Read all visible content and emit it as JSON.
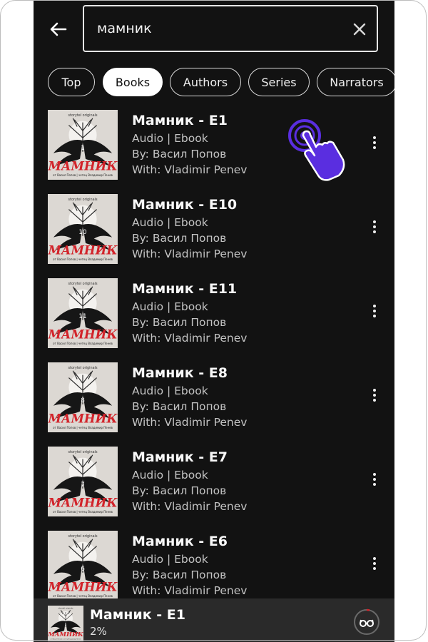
{
  "search": {
    "query": "мамник"
  },
  "tabs": [
    {
      "label": "Top",
      "active": false
    },
    {
      "label": "Books",
      "active": true
    },
    {
      "label": "Authors",
      "active": false
    },
    {
      "label": "Series",
      "active": false
    },
    {
      "label": "Narrators",
      "active": false
    }
  ],
  "results": [
    {
      "title": "Мамник - E1",
      "format": "Audio | Ebook",
      "author": "By: Васил Попов",
      "narrator": "With: Vladimir Penev",
      "cover_number": "1"
    },
    {
      "title": "Мамник - E10",
      "format": "Audio | Ebook",
      "author": "By: Васил Попов",
      "narrator": "With: Vladimir Penev",
      "cover_number": "10"
    },
    {
      "title": "Мамник - E11",
      "format": "Audio | Ebook",
      "author": "By: Васил Попов",
      "narrator": "With: Vladimir Penev",
      "cover_number": "11"
    },
    {
      "title": "Мамник - E8",
      "format": "Audio | Ebook",
      "author": "By: Васил Попов",
      "narrator": "With: Vladimir Penev",
      "cover_number": "8"
    },
    {
      "title": "Мамник - E7",
      "format": "Audio | Ebook",
      "author": "By: Васил Попов",
      "narrator": "With: Vladimir Penev",
      "cover_number": "7"
    },
    {
      "title": "Мамник - E6",
      "format": "Audio | Ebook",
      "author": "By: Васил Попов",
      "narrator": "With: Vladimir Penev",
      "cover_number": "6"
    }
  ],
  "cover_art": {
    "title": "МАМНИК",
    "brand": "storytel originals",
    "credits": "от Васил Попов | четец Владимир Пенев"
  },
  "player": {
    "title": "Мамник - E1",
    "progress": "2%",
    "cover_number": "1"
  },
  "colors": {
    "background": "#121212",
    "player_bg": "#2a2a2a",
    "tap_hint": "#5a2ee0",
    "accent_red": "#d2232a"
  },
  "icons": {
    "back": "arrow-left-icon",
    "clear": "close-icon",
    "more": "more-vertical-icon",
    "player": "reading-glasses-icon",
    "tap": "tap-hand-icon"
  }
}
